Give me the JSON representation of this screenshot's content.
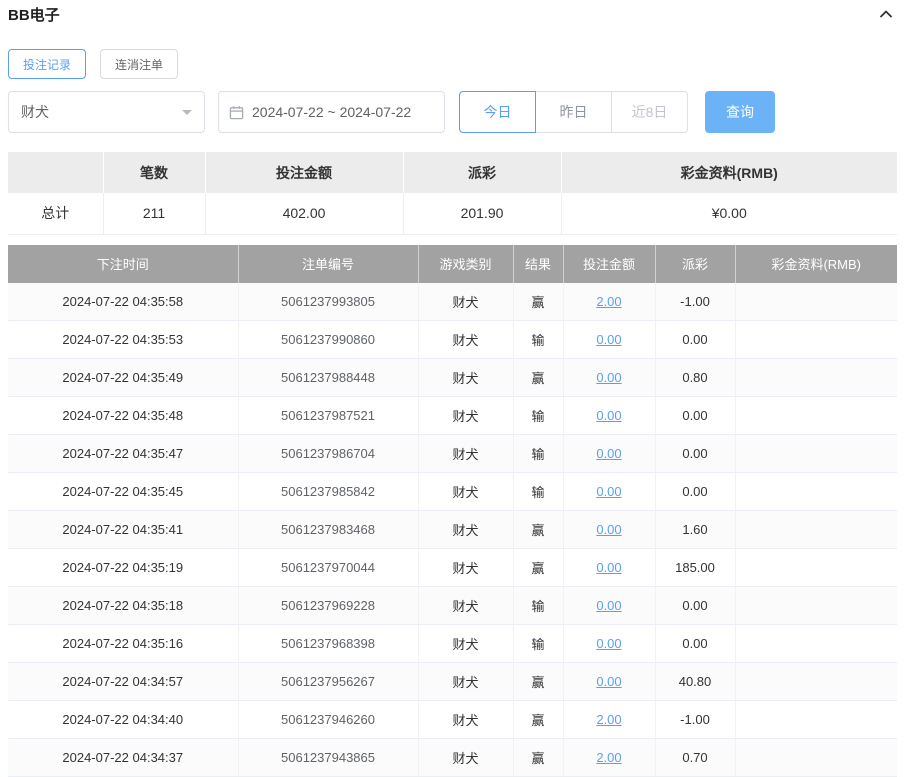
{
  "header": {
    "title": "BB电子"
  },
  "tabs": [
    {
      "label": "投注记录",
      "active": true
    },
    {
      "label": "连消注单",
      "active": false
    }
  ],
  "filters": {
    "game_select": {
      "value": "财犬"
    },
    "date_range": {
      "value": "2024-07-22 ~ 2024-07-22"
    },
    "quick_buttons": [
      {
        "label": "今日",
        "active": true
      },
      {
        "label": "昨日",
        "active": false
      },
      {
        "label": "近8日",
        "active": false
      }
    ],
    "search_label": "查询"
  },
  "summary": {
    "headers": [
      "",
      "笔数",
      "投注金额",
      "派彩",
      "彩金资料(RMB)"
    ],
    "row": {
      "label": "总计",
      "count": "211",
      "bet_amount": "402.00",
      "payout": "201.90",
      "bonus": "¥0.00"
    }
  },
  "table": {
    "headers": [
      "下注时间",
      "注单编号",
      "游戏类别",
      "结果",
      "投注金额",
      "派彩",
      "彩金资料(RMB)"
    ],
    "rows": [
      [
        "2024-07-22 04:35:58",
        "5061237993805",
        "财犬",
        "赢",
        "2.00",
        "-1.00",
        ""
      ],
      [
        "2024-07-22 04:35:53",
        "5061237990860",
        "财犬",
        "输",
        "0.00",
        "0.00",
        ""
      ],
      [
        "2024-07-22 04:35:49",
        "5061237988448",
        "财犬",
        "赢",
        "0.00",
        "0.80",
        ""
      ],
      [
        "2024-07-22 04:35:48",
        "5061237987521",
        "财犬",
        "输",
        "0.00",
        "0.00",
        ""
      ],
      [
        "2024-07-22 04:35:47",
        "5061237986704",
        "财犬",
        "输",
        "0.00",
        "0.00",
        ""
      ],
      [
        "2024-07-22 04:35:45",
        "5061237985842",
        "财犬",
        "输",
        "0.00",
        "0.00",
        ""
      ],
      [
        "2024-07-22 04:35:41",
        "5061237983468",
        "财犬",
        "赢",
        "0.00",
        "1.60",
        ""
      ],
      [
        "2024-07-22 04:35:19",
        "5061237970044",
        "财犬",
        "赢",
        "0.00",
        "185.00",
        ""
      ],
      [
        "2024-07-22 04:35:18",
        "5061237969228",
        "财犬",
        "输",
        "0.00",
        "0.00",
        ""
      ],
      [
        "2024-07-22 04:35:16",
        "5061237968398",
        "财犬",
        "输",
        "0.00",
        "0.00",
        ""
      ],
      [
        "2024-07-22 04:34:57",
        "5061237956267",
        "财犬",
        "赢",
        "0.00",
        "40.80",
        ""
      ],
      [
        "2024-07-22 04:34:40",
        "5061237946260",
        "财犬",
        "赢",
        "2.00",
        "-1.00",
        ""
      ],
      [
        "2024-07-22 04:34:37",
        "5061237943865",
        "财犬",
        "赢",
        "2.00",
        "0.70",
        ""
      ]
    ]
  },
  "colors": {
    "accent_blue": "#5b9ff5",
    "button_blue": "#6cb2f7",
    "negative_red": "#f56c6c",
    "table_header_gray": "#a2a2a2",
    "summary_header_gray": "#ececec"
  }
}
